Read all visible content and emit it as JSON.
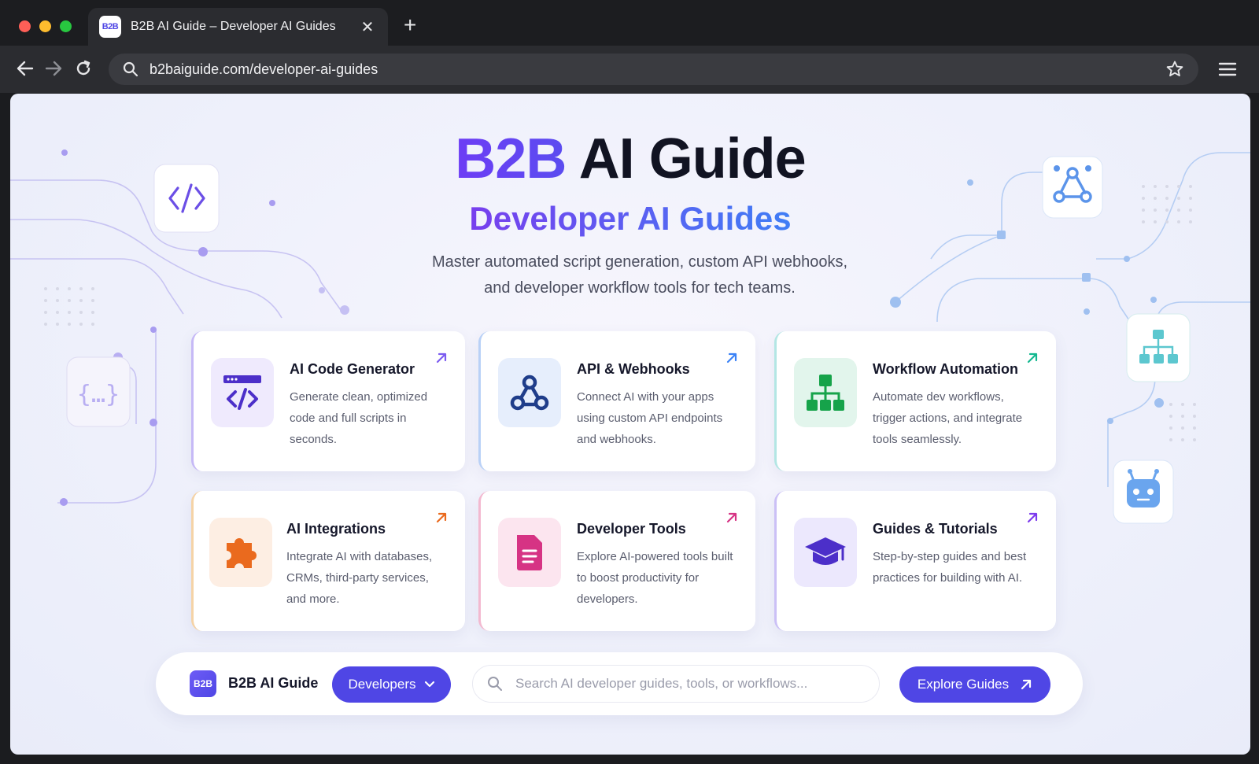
{
  "browser": {
    "tab_title": "B2B AI Guide – Developer AI Guides",
    "favicon_text": "B2B",
    "url": "b2baiguide.com/developer-ai-guides",
    "traffic_colors": [
      "#ff5f57",
      "#febc2e",
      "#28c840"
    ]
  },
  "hero": {
    "brand": "B2B",
    "title_rest": "AI Guide",
    "subtitle": "Developer AI Guides",
    "description_line1": "Master automated script generation, custom API webhooks,",
    "description_line2": "and developer workflow tools for tech teams."
  },
  "cards": [
    {
      "title": "AI Code Generator",
      "desc": "Generate clean, optimized code and full scripts in seconds.",
      "icon": "code-window-icon",
      "accent": "#7c5cf0",
      "bg": "#efeafd"
    },
    {
      "title": "API & Webhooks",
      "desc": "Connect AI with your apps using custom API endpoints and webhooks.",
      "icon": "webhook-icon",
      "accent": "#3b82f6",
      "bg": "#e6eefc"
    },
    {
      "title": "Workflow Automation",
      "desc": "Automate dev workflows, trigger actions, and integrate tools seamlessly.",
      "icon": "sitemap-icon",
      "accent": "#14b8a6",
      "bg": "#e2f5ec"
    },
    {
      "title": "AI Integrations",
      "desc": "Integrate AI with databases, CRMs, third-party services, and more.",
      "icon": "puzzle-icon",
      "accent": "#f59e0b",
      "bg": "#fdeee3"
    },
    {
      "title": "Developer Tools",
      "desc": "Explore AI-powered tools built to boost productivity for developers.",
      "icon": "document-icon",
      "accent": "#ec4899",
      "bg": "#fce5ef"
    },
    {
      "title": "Guides & Tutorials",
      "desc": "Step-by-step guides and best practices for building with AI.",
      "icon": "graduation-cap-icon",
      "accent": "#8b5cf6",
      "bg": "#ece8fd"
    }
  ],
  "bottom_bar": {
    "logo_text": "B2B",
    "brand": "B2B AI Guide",
    "dropdown_label": "Developers",
    "search_placeholder": "Search AI developer guides, tools, or workflows...",
    "cta_label": "Explore Guides"
  }
}
